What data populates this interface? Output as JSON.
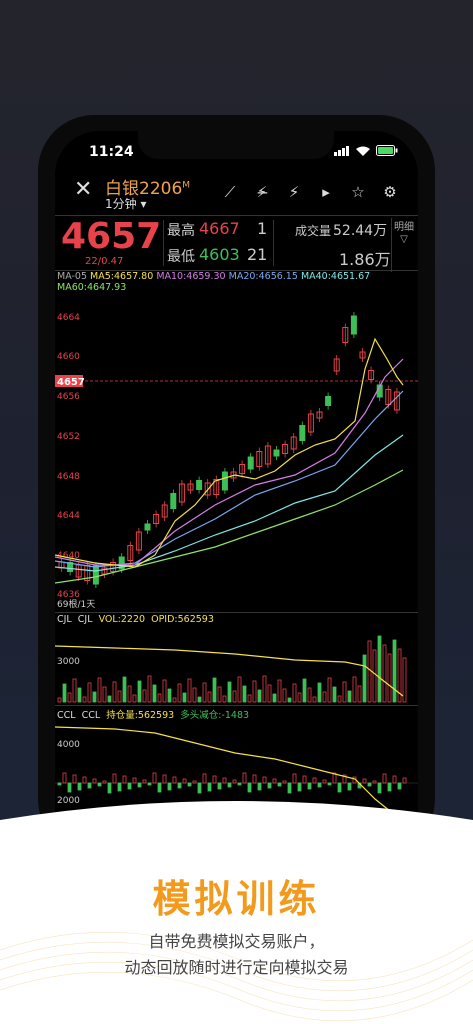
{
  "status": {
    "time": "11:24"
  },
  "header": {
    "instrument": "白银2206",
    "sup": "M",
    "period": "1分钟"
  },
  "tools": [
    "draw-line-icon",
    "draw-tool-icon",
    "lightning-icon",
    "play-icon",
    "star-add-icon",
    "gear-icon"
  ],
  "quote": {
    "price": "4657",
    "change": "22/0.47",
    "high_label": "最高",
    "high": "4667",
    "high_qty": "1",
    "low_label": "最低",
    "low": "4603",
    "low_qty": "21",
    "volume_label": "成交量",
    "volume": "52.44万",
    "turnover": "1.86万",
    "detail_label": "明细"
  },
  "ma": {
    "ma05": "MA-05",
    "ma5": "MA5:4657.80",
    "ma10": "MA10:4659.30",
    "ma20": "MA20:4656.15",
    "ma40": "MA40:4651.67",
    "ma60": "MA60:4647.93"
  },
  "axis": {
    "y": [
      "4664",
      "4660",
      "4656",
      "4652",
      "4648",
      "4644",
      "4640",
      "4636"
    ],
    "price_tag": "4657",
    "bar_count": "69根/1天"
  },
  "vol_panel": {
    "cjl_a": "CJL",
    "cjl_b": "CJL",
    "vol": "VOL:2220",
    "opid": "OPID:562593",
    "tick": "3000"
  },
  "ccl_panel": {
    "ccl_a": "CCL",
    "ccl_b": "CCL",
    "hold": "持仓量:562593",
    "note": "多头减仓:-1483",
    "tick1": "4000",
    "tick2": "2000"
  },
  "colors": {
    "up": "#e8434a",
    "down": "#3fbf56",
    "accent": "#f39a1c"
  },
  "promo": {
    "slogan": "模拟训练",
    "line1": "自带免费模拟交易账户，",
    "line2": "动态回放随时进行定向模拟交易"
  }
}
